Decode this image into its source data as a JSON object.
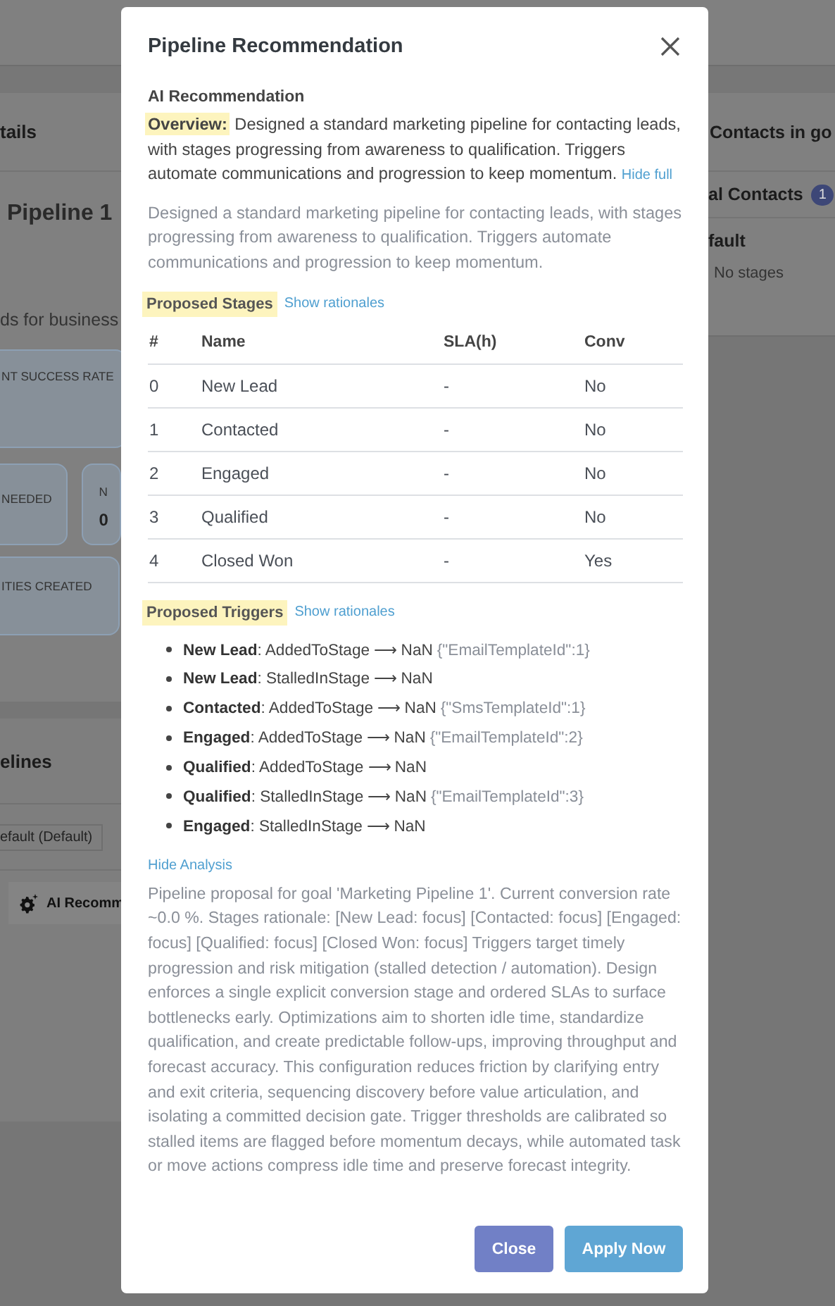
{
  "background": {
    "left": {
      "heading": "tails",
      "title": "Pipeline 1",
      "description": "ds for business",
      "metrics": [
        {
          "label": "NT SUCCESS RATE"
        },
        {
          "label": "NEEDED"
        },
        {
          "label": "N",
          "value": "0"
        },
        {
          "label": "ITIES CREATED"
        }
      ],
      "section": "elines",
      "select": "efault (Default)",
      "ai_button": "AI Recomm"
    },
    "right": {
      "heading": "Contacts in go",
      "subheading": "al Contacts",
      "count": "1",
      "pipeline": "fault",
      "empty": "No stages"
    }
  },
  "dialog": {
    "title": "Pipeline Recommendation",
    "section": "AI Recommendation",
    "overview": {
      "label": "Overview:",
      "text": "Designed a standard marketing pipeline for contacting leads, with stages progressing from awareness to qualification. Triggers automate communications and progression to keep momentum.",
      "toggle": "Hide full"
    },
    "full_text": "Designed a standard marketing pipeline for contacting leads, with stages progressing from awareness to qualification. Triggers automate communications and progression to keep momentum.",
    "stages": {
      "label": "Proposed Stages",
      "toggle": "Show rationales",
      "columns": [
        "#",
        "Name",
        "SLA(h)",
        "Conv"
      ],
      "rows": [
        {
          "index": "0",
          "name": "New Lead",
          "sla": "-",
          "conv": "No"
        },
        {
          "index": "1",
          "name": "Contacted",
          "sla": "-",
          "conv": "No"
        },
        {
          "index": "2",
          "name": "Engaged",
          "sla": "-",
          "conv": "No"
        },
        {
          "index": "3",
          "name": "Qualified",
          "sla": "-",
          "conv": "No"
        },
        {
          "index": "4",
          "name": "Closed Won",
          "sla": "-",
          "conv": "Yes"
        }
      ]
    },
    "triggers": {
      "label": "Proposed Triggers",
      "toggle": "Show rationales",
      "items": [
        {
          "stage": "New Lead",
          "action": ": AddedToStage ⟶ NaN",
          "params": "{\"EmailTemplateId\":1}"
        },
        {
          "stage": "New Lead",
          "action": ": StalledInStage ⟶ NaN"
        },
        {
          "stage": "Contacted",
          "action": ": AddedToStage ⟶ NaN",
          "params": "{\"SmsTemplateId\":1}"
        },
        {
          "stage": "Engaged",
          "action": ": AddedToStage ⟶ NaN",
          "params": "{\"EmailTemplateId\":2}"
        },
        {
          "stage": "Qualified",
          "action": ": AddedToStage ⟶ NaN"
        },
        {
          "stage": "Qualified",
          "action": ": StalledInStage ⟶ NaN",
          "params": "{\"EmailTemplateId\":3}"
        },
        {
          "stage": "Engaged",
          "action": ": StalledInStage ⟶ NaN"
        }
      ]
    },
    "analysis": {
      "toggle": "Hide Analysis",
      "text": "Pipeline proposal for goal 'Marketing Pipeline 1'. Current conversion rate ~0.0 %. Stages rationale: [New Lead: focus] [Contacted: focus] [Engaged: focus] [Qualified: focus] [Closed Won: focus] Triggers target timely progression and risk mitigation (stalled detection / automation). Design enforces a single explicit conversion stage and ordered SLAs to surface bottlenecks early. Optimizations aim to shorten idle time, standardize qualification, and create predictable follow-ups, improving throughput and forecast accuracy. This configuration reduces friction by clarifying entry and exit criteria, sequencing discovery before value articulation, and isolating a committed decision gate. Trigger thresholds are calibrated so stalled items are flagged before momentum decays, while automated task or move actions compress idle time and preserve forecast integrity."
    },
    "buttons": [
      {
        "label": "Close",
        "kind": "secondary"
      },
      {
        "label": "Apply Now",
        "kind": "primary"
      }
    ]
  }
}
